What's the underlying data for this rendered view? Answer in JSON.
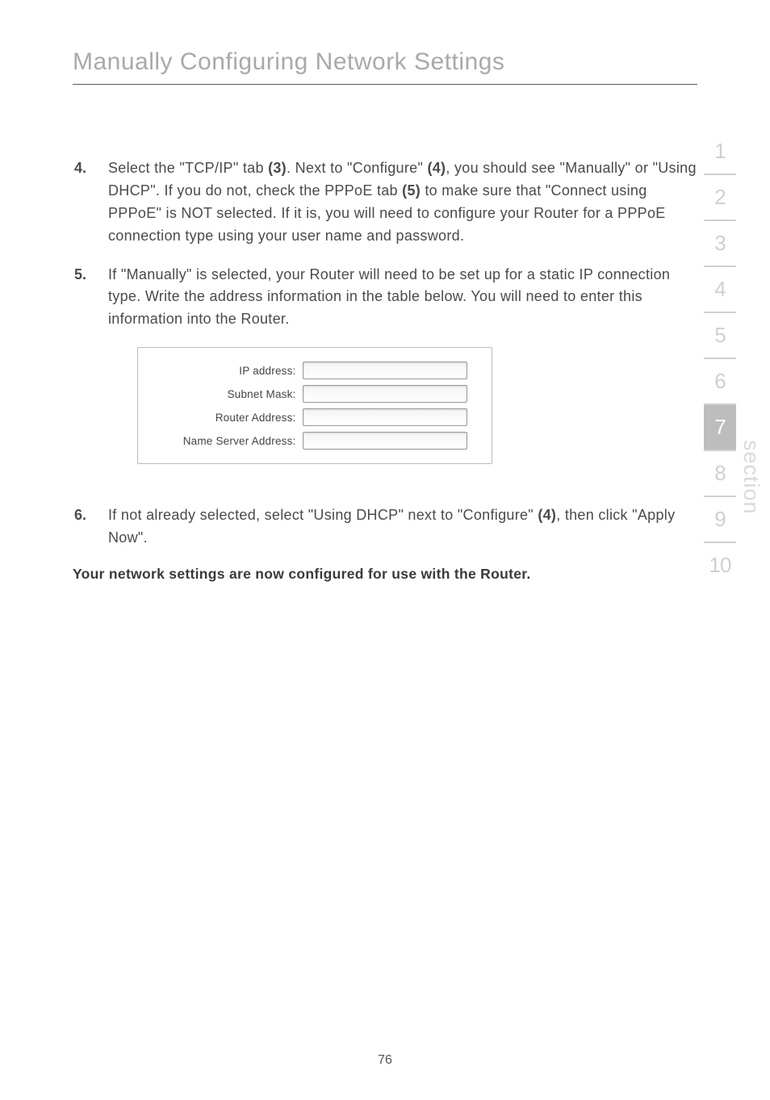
{
  "title": "Manually Configuring Network Settings",
  "items": {
    "4": {
      "num": "4.",
      "html": "Select the \"TCP/IP\" tab <b>(3)</b>. Next to \"Configure\" <b>(4)</b>, you should see \"Manually\" or \"Using DHCP\". If you do not, check the PPPoE tab <b>(5)</b> to make sure that \"Connect using PPPoE\" is NOT selected. If it is, you will need to configure your Router for a PPPoE connection type using your user name and password."
    },
    "5": {
      "num": "5.",
      "html": "If \"Manually\" is selected, your Router will need to be set up for a static IP connection type. Write the address information in the table below. You will need to enter this information into the Router."
    },
    "6": {
      "num": "6.",
      "html": "If not already selected, select \"Using DHCP\" next to \"Configure\" <b>(4)</b>, then click \"Apply Now\"."
    }
  },
  "form": {
    "ip": "IP address:",
    "subnet": "Subnet Mask:",
    "router": "Router Address:",
    "ns": "Name Server Address:",
    "values": {
      "ip": "",
      "subnet": "",
      "router": "",
      "ns": ""
    }
  },
  "final": "Your network settings are now configured for use with the Router.",
  "tabs": [
    "1",
    "2",
    "3",
    "4",
    "5",
    "6",
    "7",
    "8",
    "9",
    "10"
  ],
  "activeTab": "7",
  "sectionLabel": "section",
  "pageNumber": "76"
}
